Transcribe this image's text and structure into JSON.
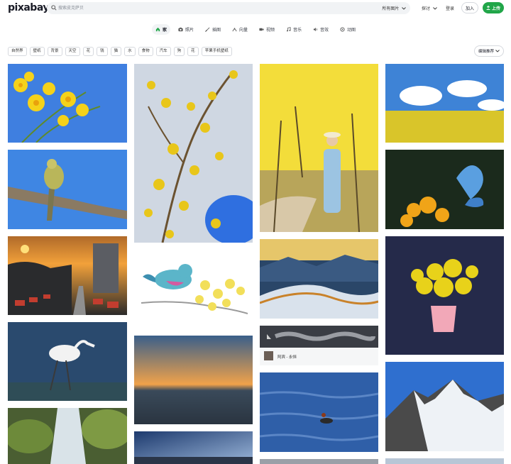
{
  "header": {
    "logo": "pixabay",
    "search_placeholder": "搜索皮克萨贝",
    "search_scope": "所有图片",
    "nav": {
      "explore": "探讨",
      "login": "登录",
      "join": "加入",
      "upload": "上传"
    }
  },
  "tabs": [
    {
      "label": "家",
      "icon": "home-icon",
      "active": true
    },
    {
      "label": "照片",
      "icon": "camera-icon",
      "active": false
    },
    {
      "label": "插图",
      "icon": "brush-icon",
      "active": false
    },
    {
      "label": "向量",
      "icon": "vector-icon",
      "active": false
    },
    {
      "label": "视频",
      "icon": "video-icon",
      "active": false
    },
    {
      "label": "音乐",
      "icon": "music-icon",
      "active": false
    },
    {
      "label": "音效",
      "icon": "sound-icon",
      "active": false
    },
    {
      "label": "动图",
      "icon": "gif-icon",
      "active": false
    }
  ],
  "chips": [
    "自然界",
    "壁纸",
    "背景",
    "天空",
    "花",
    "钱",
    "猫",
    "水",
    "食物",
    "汽车",
    "狗",
    "花",
    "苹果手机壁纸"
  ],
  "sort_label": "编辑推荐",
  "audio": {
    "title": "阿宾 - 永恒"
  },
  "colors": {
    "brand_green": "#21a649",
    "text": "#191b26",
    "chip_border": "#d6d9de"
  }
}
